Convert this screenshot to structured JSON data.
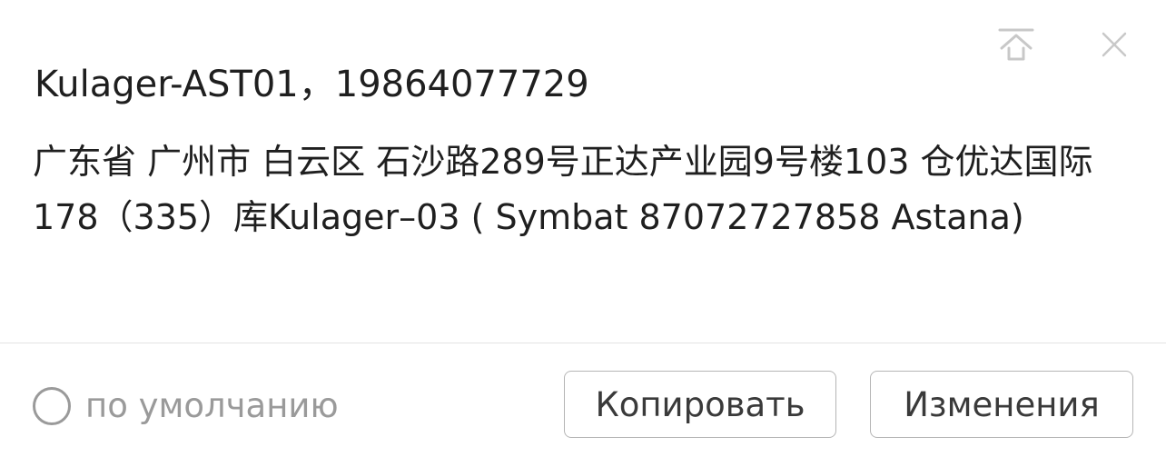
{
  "contact": {
    "text": "Kulager-AST01，19864077729"
  },
  "address": {
    "text": "广东省 广州市 白云区 石沙路289号正达产业园9号楼103 仓优达国际178（335）库Kulager–03 ( Symbat 87072727858  Astana)"
  },
  "default_option": {
    "label": "по умолчанию",
    "checked": false
  },
  "actions": {
    "copy_label": "Копировать",
    "edit_label": "Изменения"
  },
  "icons": {
    "top": "pin-to-top-icon",
    "close": "close-icon"
  },
  "colors": {
    "icon": "#c8c8c8",
    "muted_text": "#9a9a9a",
    "button_border": "#b5b5b5"
  }
}
